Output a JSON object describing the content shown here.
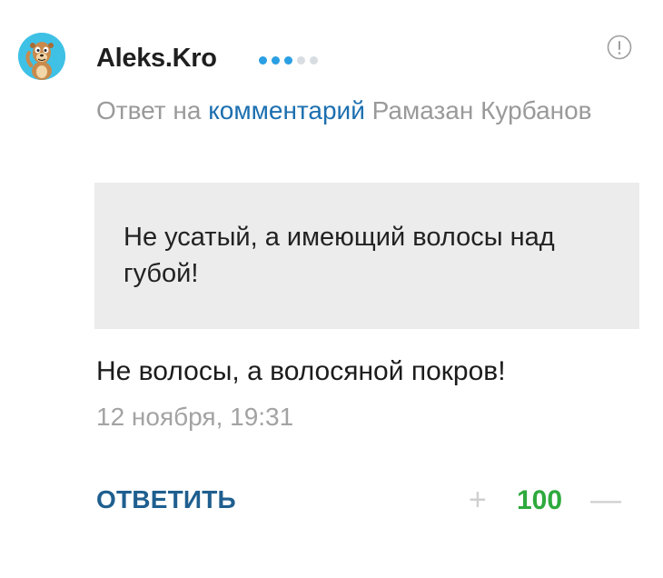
{
  "comment": {
    "author": "Aleks.Kro",
    "rating_dots": {
      "filled": 3,
      "total": 5
    },
    "reply_prefix": "Ответ на",
    "reply_link": "комментарий",
    "reply_to": "Рамазан Курбанов",
    "quote": "Не усатый, а имеющий волосы над губой!",
    "body": "Не волосы, а волосяной покров!",
    "timestamp": "12 ноября, 19:31",
    "reply_button": "ОТВЕТИТЬ",
    "score": "100",
    "vote_plus": "+",
    "vote_minus": "—"
  },
  "colors": {
    "link": "#1b6fb0",
    "reply_button": "#1f5f8f",
    "score_positive": "#2eaa3d",
    "rating_dot": "#2a9fe3"
  },
  "icons": {
    "avatar": "cartoon-meerkat-avatar",
    "info": "exclamation-circle-icon"
  }
}
